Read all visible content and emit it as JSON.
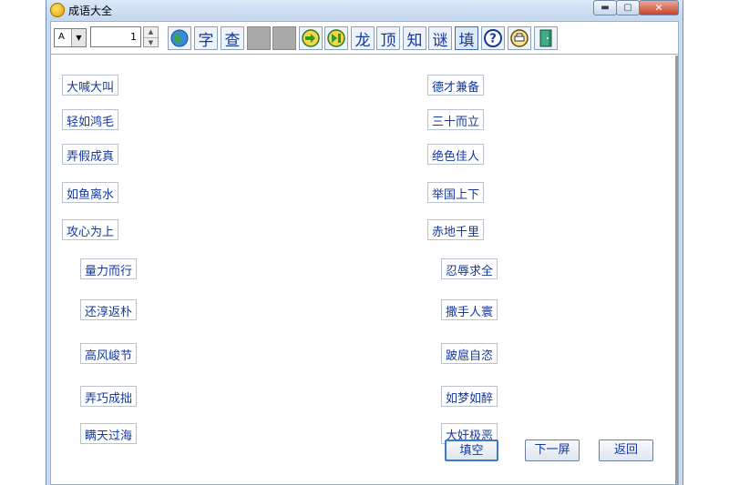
{
  "window": {
    "title": "成语大全"
  },
  "toolbar": {
    "combo_value": "A",
    "number_value": "1",
    "buttons": [
      {
        "icon": "globe-icon",
        "text": ""
      },
      {
        "icon": "",
        "text": "字"
      },
      {
        "icon": "",
        "text": "查"
      },
      {
        "icon": "blank-icon",
        "text": ""
      },
      {
        "icon": "blank-icon",
        "text": ""
      },
      {
        "icon": "arrow-right-icon",
        "text": ""
      },
      {
        "icon": "skip-icon",
        "text": ""
      },
      {
        "icon": "",
        "text": "龙"
      },
      {
        "icon": "",
        "text": "顶"
      },
      {
        "icon": "",
        "text": "知"
      },
      {
        "icon": "",
        "text": "谜"
      },
      {
        "icon": "",
        "text": "填"
      },
      {
        "icon": "help-icon",
        "text": ""
      },
      {
        "icon": "printer-icon",
        "text": ""
      },
      {
        "icon": "exit-door-icon",
        "text": ""
      }
    ]
  },
  "idioms_left": [
    "大喊大叫",
    "轻如鸿毛",
    "弄假成真",
    "如鱼离水",
    "攻心为上",
    "量力而行",
    "还淳返朴",
    "高风峻节",
    "弄巧成拙",
    "瞒天过海"
  ],
  "idioms_right": [
    "德才兼备",
    "三十而立",
    "绝色佳人",
    "举国上下",
    "赤地千里",
    "忍辱求全",
    "撒手人寰",
    "跛扈自恣",
    "如梦如醉",
    "大奸极恶"
  ],
  "buttons": {
    "fill": "填空",
    "next": "下一屏",
    "back": "返回"
  }
}
